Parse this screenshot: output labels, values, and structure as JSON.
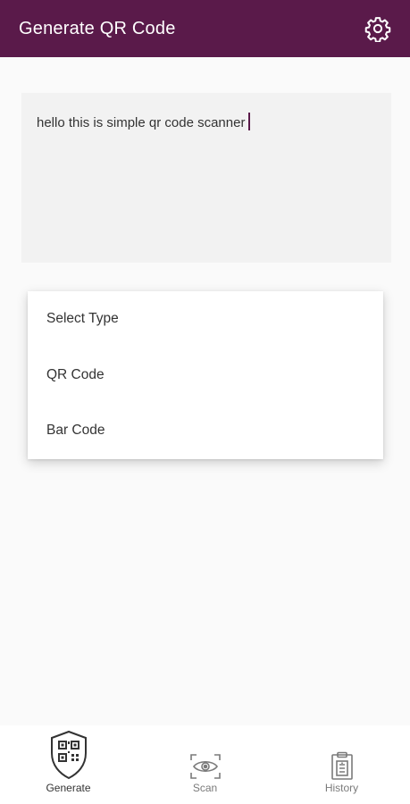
{
  "appbar": {
    "title": "Generate QR Code",
    "icon": "gear-icon",
    "color": "#5a1a4a"
  },
  "input": {
    "value": "hello this is simple qr code scanner"
  },
  "dropdown": {
    "items": [
      "Select Type",
      "QR Code",
      "Bar Code"
    ]
  },
  "bottom_nav": {
    "items": [
      {
        "label": "Generate",
        "icon": "qr-shield-icon",
        "active": true
      },
      {
        "label": "Scan",
        "icon": "scan-eye-icon",
        "active": false
      },
      {
        "label": "History",
        "icon": "clipboard-history-icon",
        "active": false
      }
    ]
  }
}
